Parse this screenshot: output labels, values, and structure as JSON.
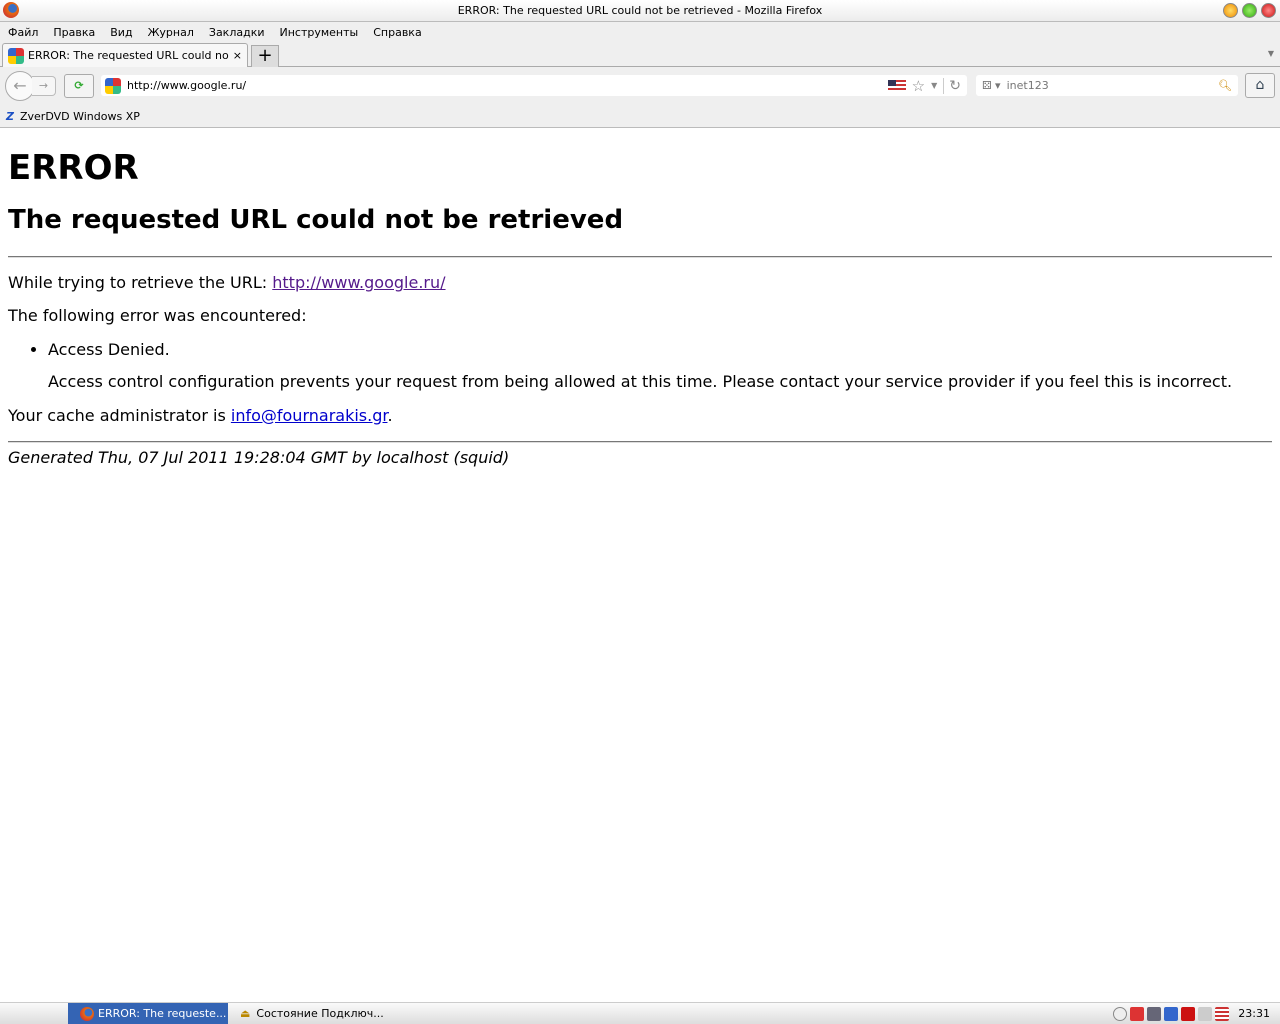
{
  "window": {
    "title": "ERROR: The requested URL could not be retrieved - Mozilla Firefox"
  },
  "menu": [
    "Файл",
    "Правка",
    "Вид",
    "Журнал",
    "Закладки",
    "Инструменты",
    "Справка"
  ],
  "tab": {
    "title": "ERROR: The requested URL could not be...",
    "close": "×",
    "new": "+"
  },
  "nav": {
    "url": "http://www.google.ru/",
    "search": "inet123"
  },
  "bookmarks": [
    {
      "label": "ZverDVD Windows XP"
    }
  ],
  "page": {
    "h1": "ERROR",
    "h2": "The requested URL could not be retrieved",
    "retrieve_prefix": "While trying to retrieve the URL: ",
    "retrieve_url": "http://www.google.ru/",
    "encountered": "The following error was encountered:",
    "error": "Access Denied.",
    "explanation": "Access control configuration prevents your request from being allowed at this time. Please contact your service provider if you feel this is incorrect.",
    "admin_prefix": "Your cache administrator is ",
    "admin_email": "info@fournarakis.gr",
    "admin_suffix": ".",
    "generated": "Generated Thu, 07 Jul 2011 19:28:04 GMT by localhost (squid)"
  },
  "taskbar": {
    "task1": "ERROR: The requeste...",
    "task2": "Состояние Подключ...",
    "clock": "23:31"
  }
}
